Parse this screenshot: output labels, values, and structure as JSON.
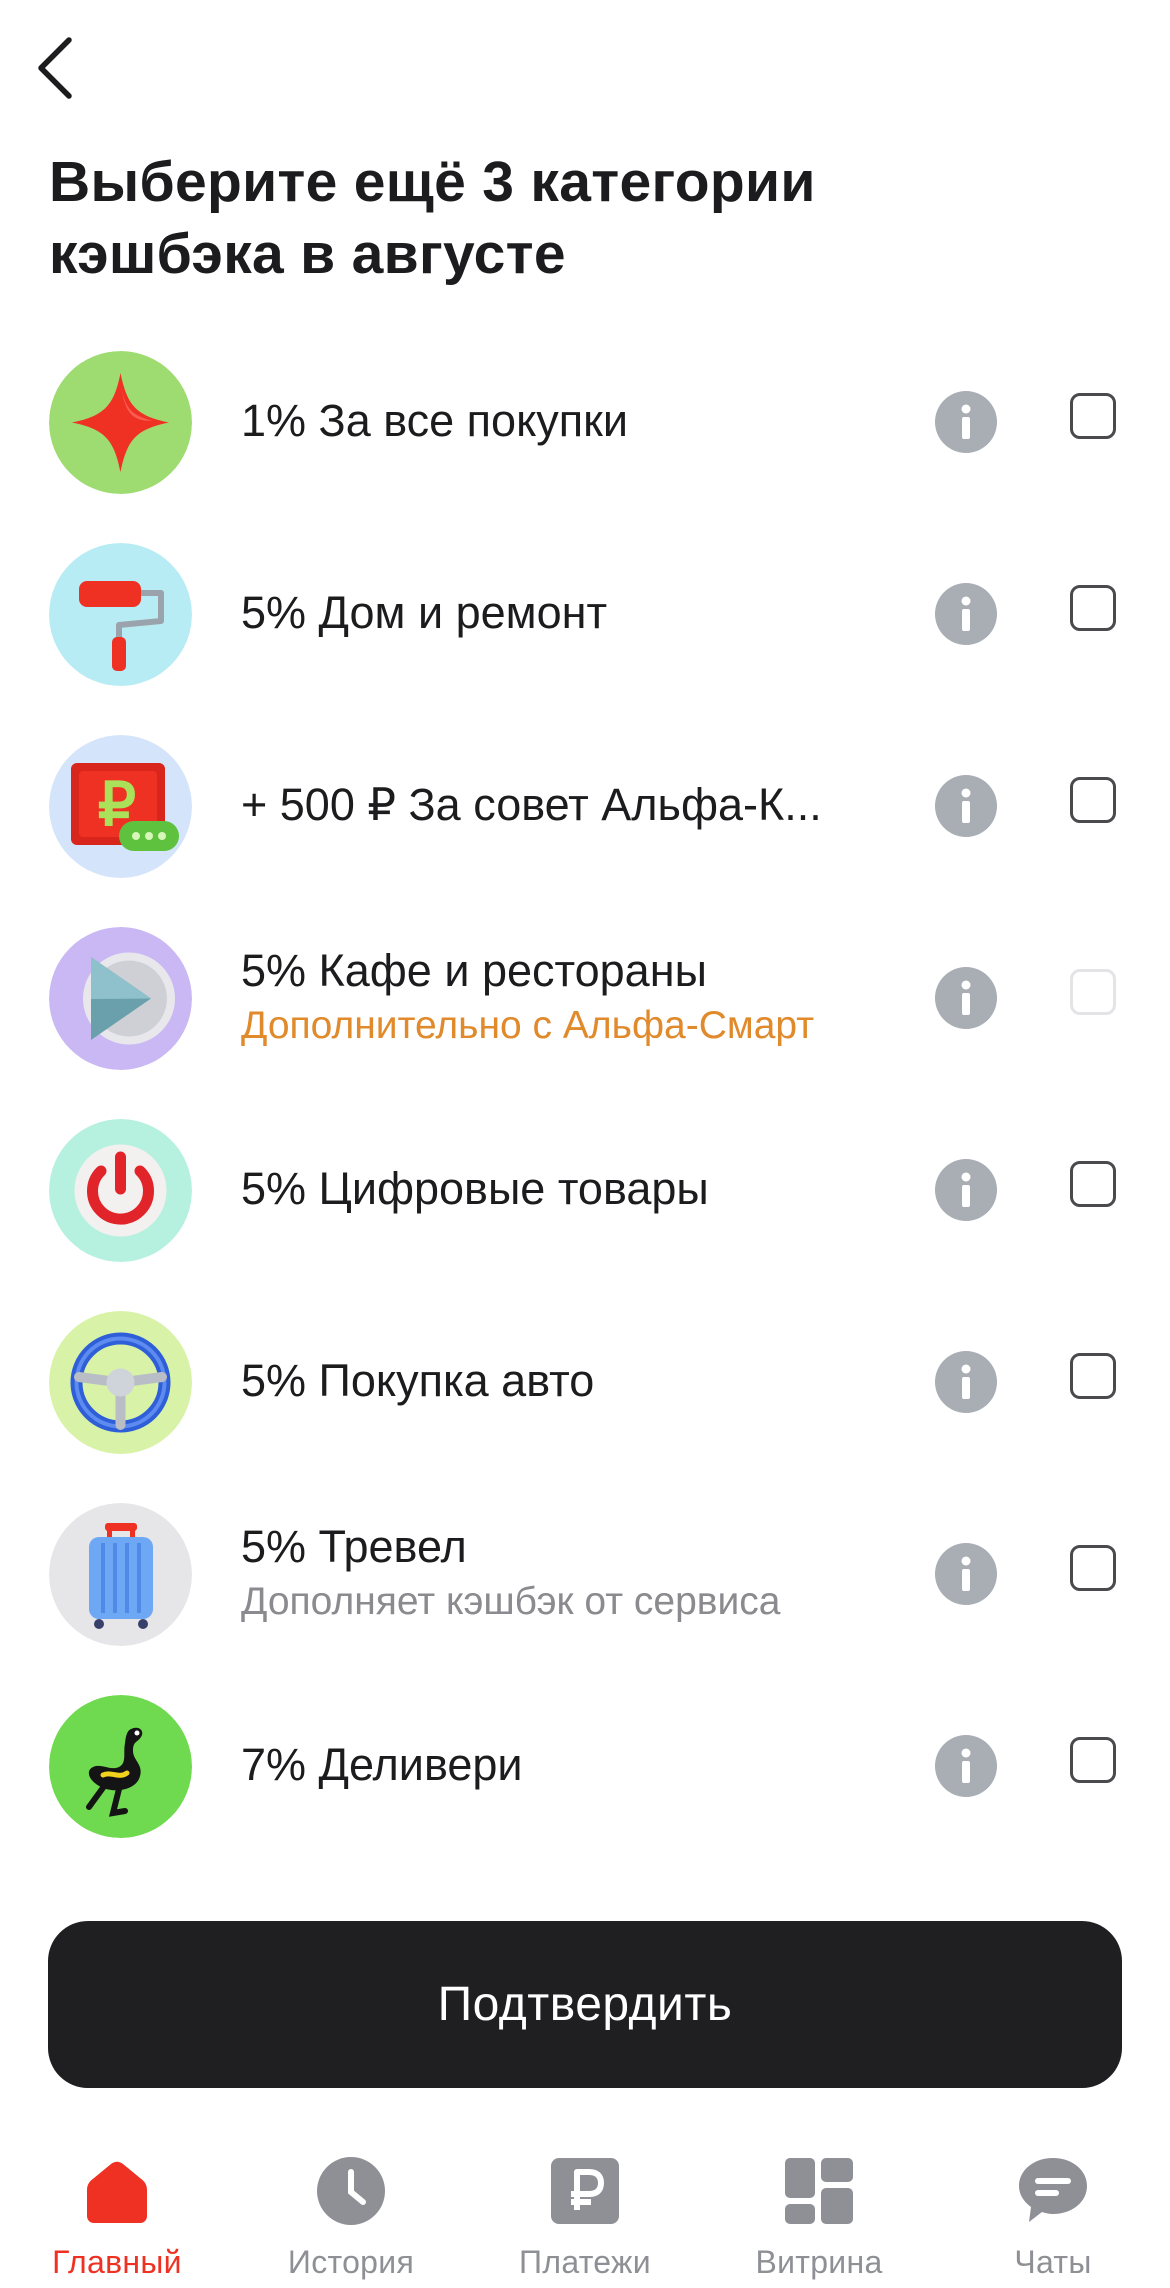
{
  "header": {
    "back_icon": "chevron-left-icon",
    "title": "Выберите ещё 3 категории кэшбэка в августе"
  },
  "categories": [
    {
      "label": "1% За все покупки",
      "icon": "star-icon",
      "checked": false,
      "enabled": true
    },
    {
      "label": "5% Дом и ремонт",
      "icon": "paint-roller-icon",
      "checked": false,
      "enabled": true
    },
    {
      "label": "+ 500 ₽ За совет Альфа-К...",
      "icon": "ruble-card-icon",
      "checked": false,
      "enabled": true
    },
    {
      "label": "5% Кафе и рестораны",
      "sublabel": "Дополнительно с Альфа-Смарт",
      "icon": "play-icon",
      "checked": false,
      "enabled": false
    },
    {
      "label": "5% Цифровые товары",
      "icon": "power-icon",
      "checked": false,
      "enabled": true
    },
    {
      "label": "5% Покупка авто",
      "icon": "steering-wheel-icon",
      "checked": false,
      "enabled": true
    },
    {
      "label": "5% Тревел",
      "sublabel": "Дополняет кэшбэк от сервиса",
      "icon": "suitcase-icon",
      "checked": false,
      "enabled": true
    },
    {
      "label": "7% Деливери",
      "icon": "ostrich-icon",
      "checked": false,
      "enabled": true
    }
  ],
  "confirm_button": {
    "label": "Подтвердить"
  },
  "tabbar": [
    {
      "label": "Главный",
      "icon": "home-icon",
      "active": true
    },
    {
      "label": "История",
      "icon": "clock-icon",
      "active": false
    },
    {
      "label": "Платежи",
      "icon": "ruble-icon",
      "active": false
    },
    {
      "label": "Витрина",
      "icon": "grid-icon",
      "active": false
    },
    {
      "label": "Чаты",
      "icon": "chat-icon",
      "active": false
    }
  ],
  "colors": {
    "accent": "#ef3124",
    "promo": "#e08a2c",
    "button": "#1f1f21",
    "info": "#a9adb4"
  }
}
